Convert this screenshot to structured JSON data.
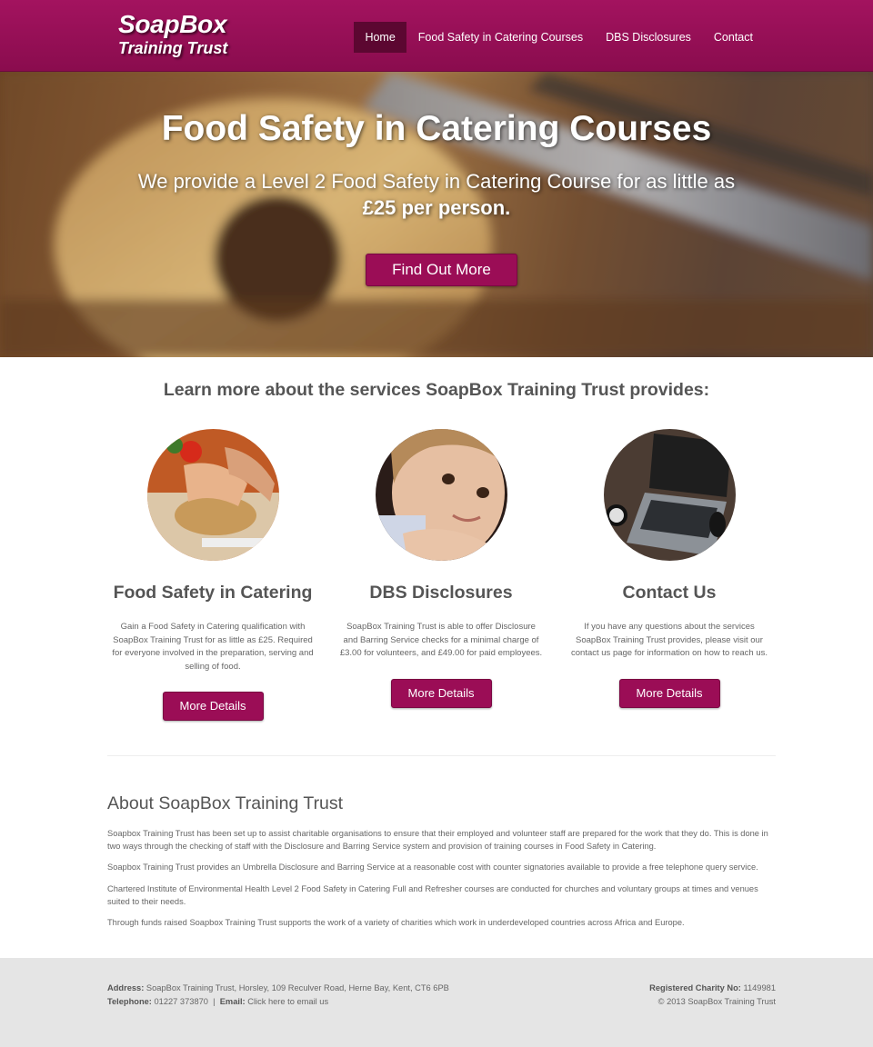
{
  "brand": {
    "line1": "SoapBox",
    "line2": "Training Trust"
  },
  "nav": {
    "items": [
      {
        "label": "Home"
      },
      {
        "label": "Food Safety in Catering Courses"
      },
      {
        "label": "DBS Disclosures"
      },
      {
        "label": "Contact"
      }
    ],
    "active_index": 0
  },
  "hero": {
    "title": "Food Safety in Catering Courses",
    "subtitle": "We provide a Level 2 Food Safety in Catering Course for as little as",
    "subtitle_strong": "£25 per person.",
    "button": "Find Out More"
  },
  "services": {
    "heading": "Learn more about the services SoapBox Training Trust provides:",
    "items": [
      {
        "title": "Food Safety in Catering",
        "text": "Gain a Food Safety in Catering qualification with SoapBox Training Trust for as little as £25. Required for everyone involved in the preparation, serving and selling of food.",
        "button": "More Details"
      },
      {
        "title": "DBS Disclosures",
        "text": "SoapBox Training Trust is able to offer Disclosure and Barring Service checks for a minimal charge of £3.00 for volunteers, and £49.00 for paid employees.",
        "button": "More Details"
      },
      {
        "title": "Contact Us",
        "text": "If you have any questions about the services SoapBox Training Trust provides, please visit our contact us page for information on how to reach us.",
        "button": "More Details"
      }
    ]
  },
  "about": {
    "title": "About SoapBox Training Trust",
    "paragraphs": [
      "Soapbox Training Trust has been set up to assist charitable organisations to ensure that their employed and volunteer staff are prepared for the work that they do. This is done in two ways through the checking of staff with the Disclosure and Barring Service system and provision of training courses in Food Safety in Catering.",
      "Soapbox Training Trust provides an Umbrella Disclosure and Barring Service at a reasonable cost with counter signatories available to provide a free telephone query service.",
      "Chartered Institute of Environmental Health Level 2 Food Safety in Catering Full and Refresher courses are conducted for churches and voluntary groups at times and venues suited to their needs.",
      "Through funds raised Soapbox Training Trust supports the work of a variety of charities which work in underdeveloped countries across Africa and Europe."
    ]
  },
  "footer": {
    "address_label": "Address:",
    "address": "SoapBox Training Trust, Horsley, 109 Reculver Road, Herne Bay, Kent, CT6 6PB",
    "telephone_label": "Telephone:",
    "telephone": "01227 373870",
    "separator": "|",
    "email_label": "Email:",
    "email_link": "Click here to email us",
    "charity_label": "Registered Charity No:",
    "charity_no": "1149981",
    "copyright": "© 2013 SoapBox Training Trust"
  },
  "colors": {
    "brand": "#9b0d56",
    "nav_active": "#5c0731",
    "footer_bg": "#e5e5e5"
  },
  "icons": [
    "food-photo",
    "child-photo",
    "laptop-photo"
  ]
}
